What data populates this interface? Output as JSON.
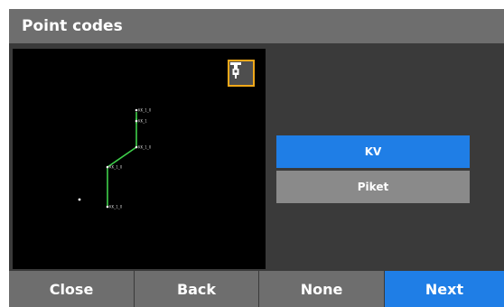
{
  "title": "Point codes",
  "toolbar": {
    "instrument_icon": "total-station-icon",
    "accent_color": "#f0a81a"
  },
  "drawing": {
    "line_color": "#3ecf4a",
    "point_labels": [
      "KK_1_0",
      "KK_1",
      "KK_1_0",
      "KK_1_0",
      "KK_1_0"
    ]
  },
  "codes": [
    {
      "label": "KV",
      "selected": true
    },
    {
      "label": "Piket",
      "selected": false
    }
  ],
  "buttons": {
    "close": "Close",
    "back": "Back",
    "none": "None",
    "next": "Next"
  },
  "colors": {
    "titlebar": "#6e6e6e",
    "background": "#3a3a3a",
    "selected": "#1f7ee6",
    "item": "#8a8a8a"
  }
}
